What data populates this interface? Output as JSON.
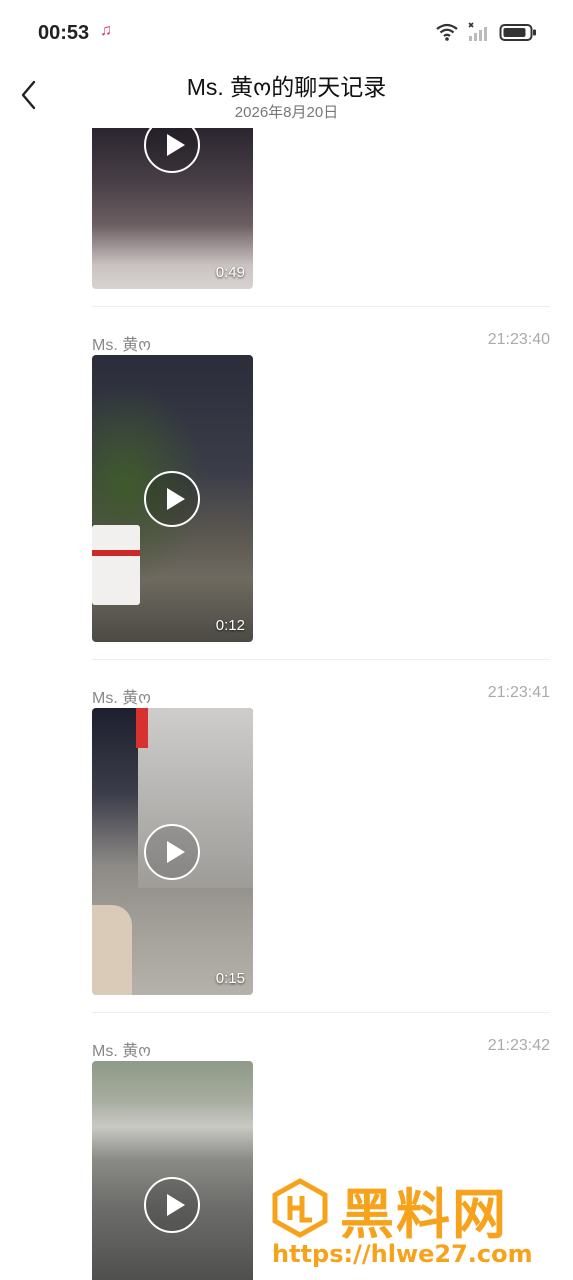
{
  "status": {
    "time": "00:53",
    "music_glyph": "♫",
    "icons": [
      "wifi-icon",
      "signal-icon",
      "battery-icon"
    ]
  },
  "header": {
    "title": "Ms. 黄ო的聊天记录",
    "subtitle": "2026年8月20日"
  },
  "messages": [
    {
      "sender": "",
      "time": "",
      "duration": "0:49"
    },
    {
      "sender": "Ms. 黄ო",
      "time": "21:23:40",
      "duration": "0:12"
    },
    {
      "sender": "Ms. 黄ო",
      "time": "21:23:41",
      "duration": "0:15"
    },
    {
      "sender": "Ms. 黄ო",
      "time": "21:23:42",
      "duration": ""
    }
  ],
  "watermark": {
    "text": "黑料网",
    "url": "https://hlwe27.com",
    "color": "#f7a21b"
  }
}
